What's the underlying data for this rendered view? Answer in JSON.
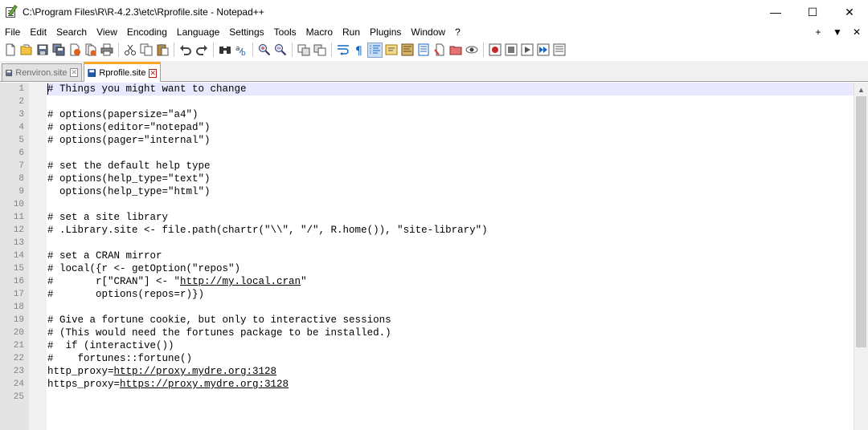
{
  "window": {
    "title": "C:\\Program Files\\R\\R-4.2.3\\etc\\Rprofile.site - Notepad++",
    "minimize": "—",
    "maximize": "☐",
    "close": "✕"
  },
  "menu": {
    "items": [
      "File",
      "Edit",
      "Search",
      "View",
      "Encoding",
      "Language",
      "Settings",
      "Tools",
      "Macro",
      "Run",
      "Plugins",
      "Window",
      "?"
    ],
    "right": [
      "+",
      "▼",
      "✕"
    ]
  },
  "tabs": [
    {
      "label": "Renviron.site",
      "active": false
    },
    {
      "label": "Rprofile.site",
      "active": true
    }
  ],
  "editor": {
    "current_line": 1,
    "lines": [
      {
        "num": "1",
        "text": "# Things you might want to change"
      },
      {
        "num": "2",
        "text": ""
      },
      {
        "num": "3",
        "text": "# options(papersize=\"a4\")"
      },
      {
        "num": "4",
        "text": "# options(editor=\"notepad\")"
      },
      {
        "num": "5",
        "text": "# options(pager=\"internal\")"
      },
      {
        "num": "6",
        "text": ""
      },
      {
        "num": "7",
        "text": "# set the default help type"
      },
      {
        "num": "8",
        "text": "# options(help_type=\"text\")"
      },
      {
        "num": "9",
        "text": "  options(help_type=\"html\")"
      },
      {
        "num": "10",
        "text": ""
      },
      {
        "num": "11",
        "text": "# set a site library"
      },
      {
        "num": "12",
        "text": "# .Library.site <- file.path(chartr(\"\\\\\", \"/\", R.home()), \"site-library\")"
      },
      {
        "num": "13",
        "text": ""
      },
      {
        "num": "14",
        "text": "# set a CRAN mirror"
      },
      {
        "num": "15",
        "text": "# local({r <- getOption(\"repos\")"
      },
      {
        "num": "16",
        "text": "#       r[\"CRAN\"] <- \"",
        "url": "http://my.local.cran",
        "after": "\""
      },
      {
        "num": "17",
        "text": "#       options(repos=r)})"
      },
      {
        "num": "18",
        "text": ""
      },
      {
        "num": "19",
        "text": "# Give a fortune cookie, but only to interactive sessions"
      },
      {
        "num": "20",
        "text": "# (This would need the fortunes package to be installed.)"
      },
      {
        "num": "21",
        "text": "#  if (interactive())"
      },
      {
        "num": "22",
        "text": "#    fortunes::fortune()"
      },
      {
        "num": "23",
        "text": "http_proxy=",
        "url": "http://proxy.mydre.org:3128",
        "after": ""
      },
      {
        "num": "24",
        "text": "https_proxy=",
        "url": "https://proxy.mydre.org:3128",
        "after": ""
      },
      {
        "num": "25",
        "text": ""
      }
    ]
  },
  "toolbar": {
    "buttons": [
      "new-file-icon",
      "open-file-icon",
      "save-icon",
      "save-all-icon",
      "close-icon",
      "close-all-icon",
      "print-icon",
      "cut-icon",
      "copy-icon",
      "paste-icon",
      "undo-icon",
      "redo-icon",
      "find-icon",
      "replace-icon",
      "zoom-in-icon",
      "zoom-out-icon",
      "sync-vertical-icon",
      "sync-horizontal-icon",
      "word-wrap-icon",
      "show-all-chars-icon",
      "indent-guide-icon",
      "user-language-icon",
      "doc-map-icon",
      "function-list-icon",
      "folder-workspace-icon",
      "document-list-icon",
      "monitoring-icon",
      "record-macro-icon",
      "stop-macro-icon",
      "play-macro-icon",
      "run-macro-multiple-icon",
      "save-macro-icon"
    ]
  }
}
